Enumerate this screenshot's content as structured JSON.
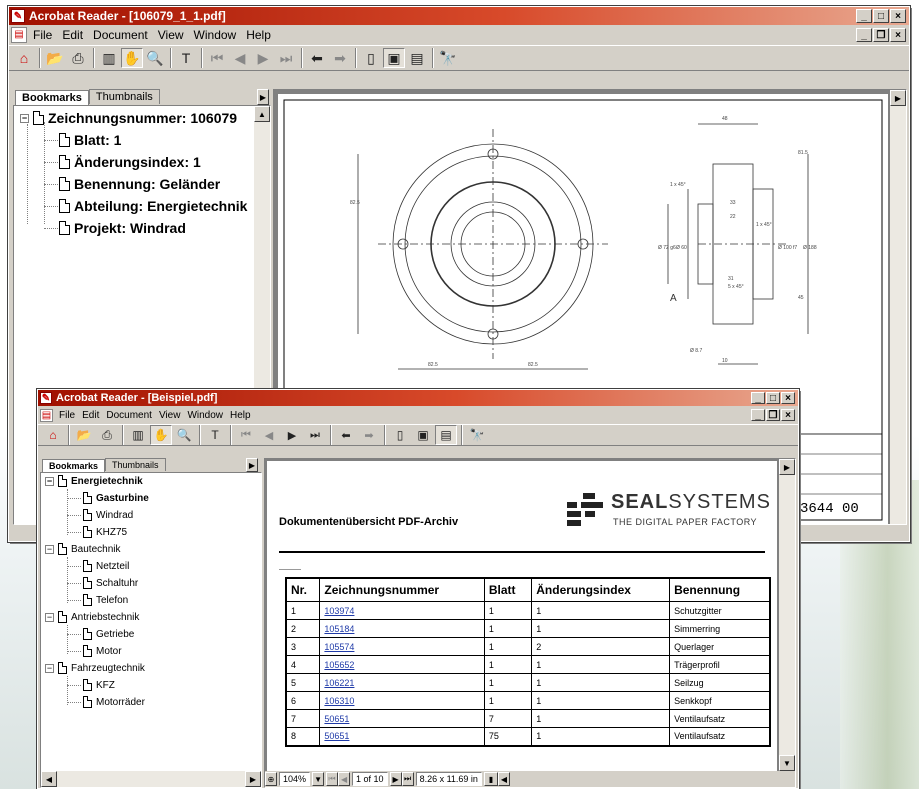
{
  "window1": {
    "title": "Acrobat Reader - [106079_1_1.pdf]",
    "menu": [
      "File",
      "Edit",
      "Document",
      "View",
      "Window",
      "Help"
    ],
    "tabs": {
      "bookmarks": "Bookmarks",
      "thumbnails": "Thumbnails"
    },
    "bookmarks": {
      "root": "Zeichnungsnummer: 106079",
      "items": [
        "Blatt: 1",
        "Änderungsindex: 1",
        "Benennung: Geländer",
        "Abteilung: Energietechnik",
        "Projekt: Windrad"
      ]
    },
    "drawing": {
      "stamp_number": "3644 00",
      "dims": {
        "top": "48",
        "d1": "1 x 45°",
        "d2": "1 x 45°",
        "d3": "33",
        "d4": "22",
        "d5": "81.5",
        "d6": "82.5",
        "d7": "82.5",
        "d8": "82.5",
        "d9": "Ø 188",
        "d10": "Ø 72 g6",
        "d11": "Ø 60",
        "d12": "Ø 100 f7",
        "label_a": "A",
        "d13": "31",
        "d14": "5 x 45°",
        "d15": "10",
        "d16": "45",
        "d17": "Ø 8.7"
      }
    }
  },
  "window2": {
    "title": "Acrobat Reader - [Beispiel.pdf]",
    "menu": [
      "File",
      "Edit",
      "Document",
      "View",
      "Window",
      "Help"
    ],
    "tabs": {
      "bookmarks": "Bookmarks",
      "thumbnails": "Thumbnails"
    },
    "tree": [
      {
        "label": "Energietechnik",
        "bold": true,
        "children": [
          {
            "label": "Gasturbine",
            "bold": true
          },
          {
            "label": "Windrad"
          },
          {
            "label": "KHZ75"
          }
        ]
      },
      {
        "label": "Bautechnik",
        "children": [
          {
            "label": "Netzteil"
          },
          {
            "label": "Schaltuhr"
          },
          {
            "label": "Telefon"
          }
        ]
      },
      {
        "label": "Antriebstechnik",
        "children": [
          {
            "label": "Getriebe"
          },
          {
            "label": "Motor"
          }
        ]
      },
      {
        "label": "Fahrzeugtechnik",
        "children": [
          {
            "label": "KFZ"
          },
          {
            "label": "Motorräder"
          }
        ]
      }
    ],
    "document": {
      "heading": "Dokumentenübersicht PDF-Archiv",
      "logo_bold": "SEAL",
      "logo_light": "SYSTEMS",
      "logo_tagline": "THE DIGITAL PAPER FACTORY",
      "columns": [
        "Nr.",
        "Zeichnungsnummer",
        "Blatt",
        "Änderungsindex",
        "Benennung"
      ],
      "rows": [
        [
          "1",
          "103974",
          "1",
          "1",
          "Schutzgitter"
        ],
        [
          "2",
          "105184",
          "1",
          "1",
          "Simmerring"
        ],
        [
          "3",
          "105574",
          "1",
          "2",
          "Querlager"
        ],
        [
          "4",
          "105652",
          "1",
          "1",
          "Trägerprofil"
        ],
        [
          "5",
          "106221",
          "1",
          "1",
          "Seilzug"
        ],
        [
          "6",
          "106310",
          "1",
          "1",
          "Senkkopf"
        ],
        [
          "7",
          "50651",
          "7",
          "1",
          "Ventilaufsatz"
        ],
        [
          "8",
          "50651",
          "75",
          "1",
          "Ventilaufsatz"
        ]
      ]
    },
    "status": {
      "zoom": "104%",
      "page": "1 of 10",
      "size": "8.26 x 11.69 in"
    }
  },
  "colors": {
    "title_start": "#a01000",
    "title_end": "#e8a890",
    "chrome": "#d4d0c8",
    "link": "#1f3aa8"
  }
}
